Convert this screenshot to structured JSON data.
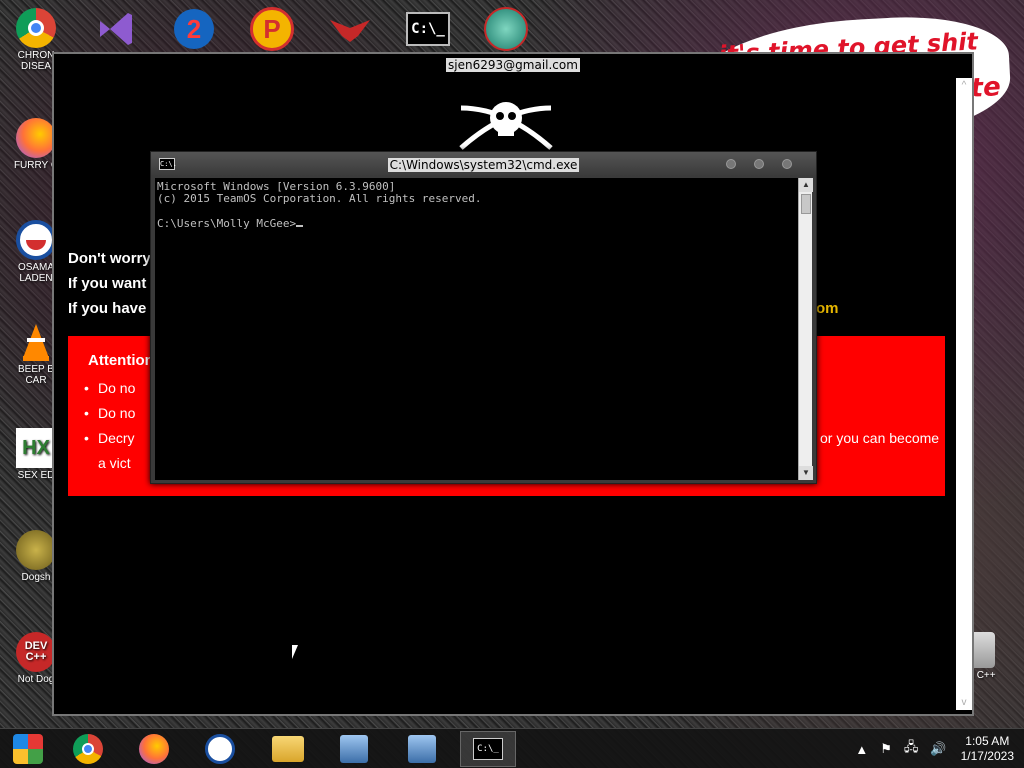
{
  "desktop": {
    "icons": [
      {
        "label": "CHRON\nDISEA",
        "icon": "chrome-icon"
      },
      {
        "label": "FURRY C",
        "icon": "firefox-icon"
      },
      {
        "label": "OSAMA\nLADEN",
        "icon": "obama-logo-icon"
      },
      {
        "label": "BEEP B\nCAR",
        "icon": "vlc-cone-icon"
      },
      {
        "label": "SEX ED",
        "icon": "hx-icon"
      },
      {
        "label": "Dogsh",
        "icon": "dog-icon"
      },
      {
        "label": "Not Dog",
        "icon": "devcpp-icon"
      }
    ],
    "recycle_label": "n C++",
    "bubble_text_1": "it's time to get shit",
    "bubble_text_2": "te"
  },
  "main_window": {
    "title": "sjen6293@gmail.com",
    "skull_icon": "skull-crossbones-icon",
    "lines": [
      "Don't worry",
      "If you want",
      "If you have"
    ],
    "email_tail": "om",
    "attention": "Attention",
    "bullets": [
      "Do no",
      "Do no",
      "Decry",
      "a vict"
    ],
    "bullet_tail": "or you can become"
  },
  "cmd": {
    "title": "C:\\Windows\\system32\\cmd.exe",
    "icon_text": "C:\\.",
    "line1": "Microsoft Windows [Version 6.3.9600]",
    "line2": "(c) 2015 TeamOS Corporation. All rights reserved.",
    "prompt": "C:\\Users\\Molly McGee>"
  },
  "taskbar": {
    "buttons": [
      {
        "name": "taskbar-start-button",
        "icon": "start-orb-icon"
      },
      {
        "name": "taskbar-chrome",
        "icon": "chrome-icon"
      },
      {
        "name": "taskbar-firefox",
        "icon": "firefox-icon"
      },
      {
        "name": "taskbar-obama",
        "icon": "obama-logo-icon"
      },
      {
        "name": "taskbar-explorer",
        "icon": "folder-icon"
      },
      {
        "name": "taskbar-installer-1",
        "icon": "installer-icon"
      },
      {
        "name": "taskbar-installer-2",
        "icon": "installer-icon"
      },
      {
        "name": "taskbar-cmd",
        "icon": "cmd-icon"
      }
    ],
    "cmd_icon_text": "C:\\_",
    "time": "1:05 AM",
    "date": "1/17/2023"
  },
  "colors": {
    "red_box": "#ff0000",
    "email_yellow": "#e7b600",
    "cmd_text": "#c0c0c0"
  }
}
